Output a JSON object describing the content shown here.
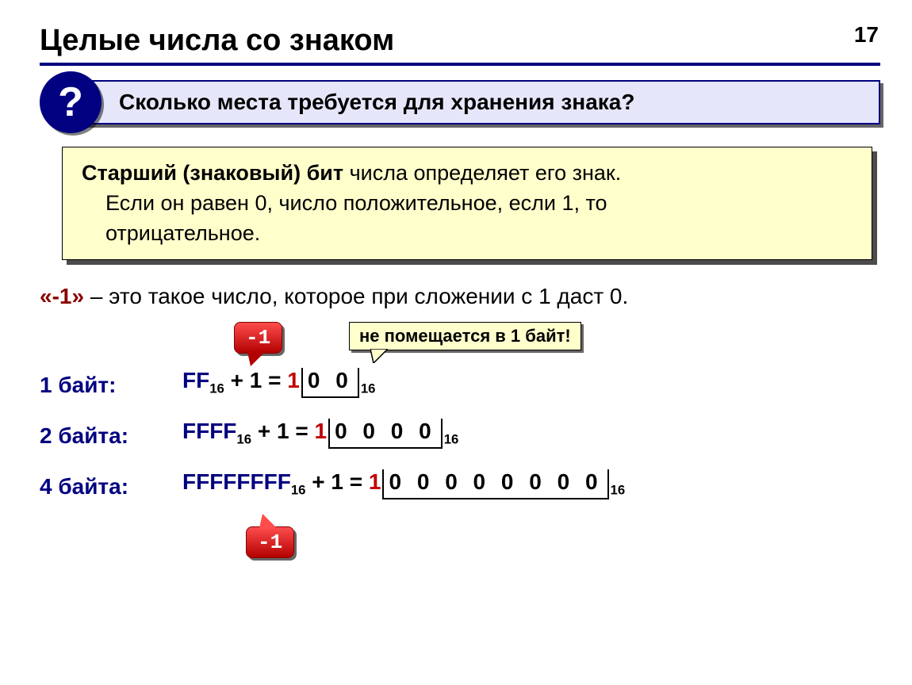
{
  "page_number": "17",
  "title": "Целые числа со знаком",
  "question_mark": "?",
  "question_text": "Сколько места требуется для хранения знака?",
  "info_bold": "Старший (знаковый) бит",
  "info_rest_line1": " числа определяет его знак.",
  "info_line2": "Если он равен 0, число положительное, если 1, то",
  "info_line3": "отрицательное.",
  "def_prefix": "«-1»",
  "def_rest": " – это такое число, которое при сложении с 1 даст 0.",
  "callout_top": "-1",
  "callout_bottom": "-1",
  "note_text": "не помещается в 1 байт!",
  "rows": [
    {
      "label": "1 байт:",
      "hex": "FF",
      "sub": "16",
      "plus": " + 1 = ",
      "one": "1",
      "zeros": "0 0",
      "sub2": "16"
    },
    {
      "label": "2 байта:",
      "hex": "FFFF",
      "sub": "16",
      "plus": " + 1 = ",
      "one": "1",
      "zeros": "0 0 0 0",
      "sub2": "16"
    },
    {
      "label": "4 байта:",
      "hex": "FFFFFFFF",
      "sub": "16",
      "plus": " + 1 = ",
      "one": "1",
      "zeros": "0 0 0 0 0 0 0 0",
      "sub2": "16"
    }
  ]
}
